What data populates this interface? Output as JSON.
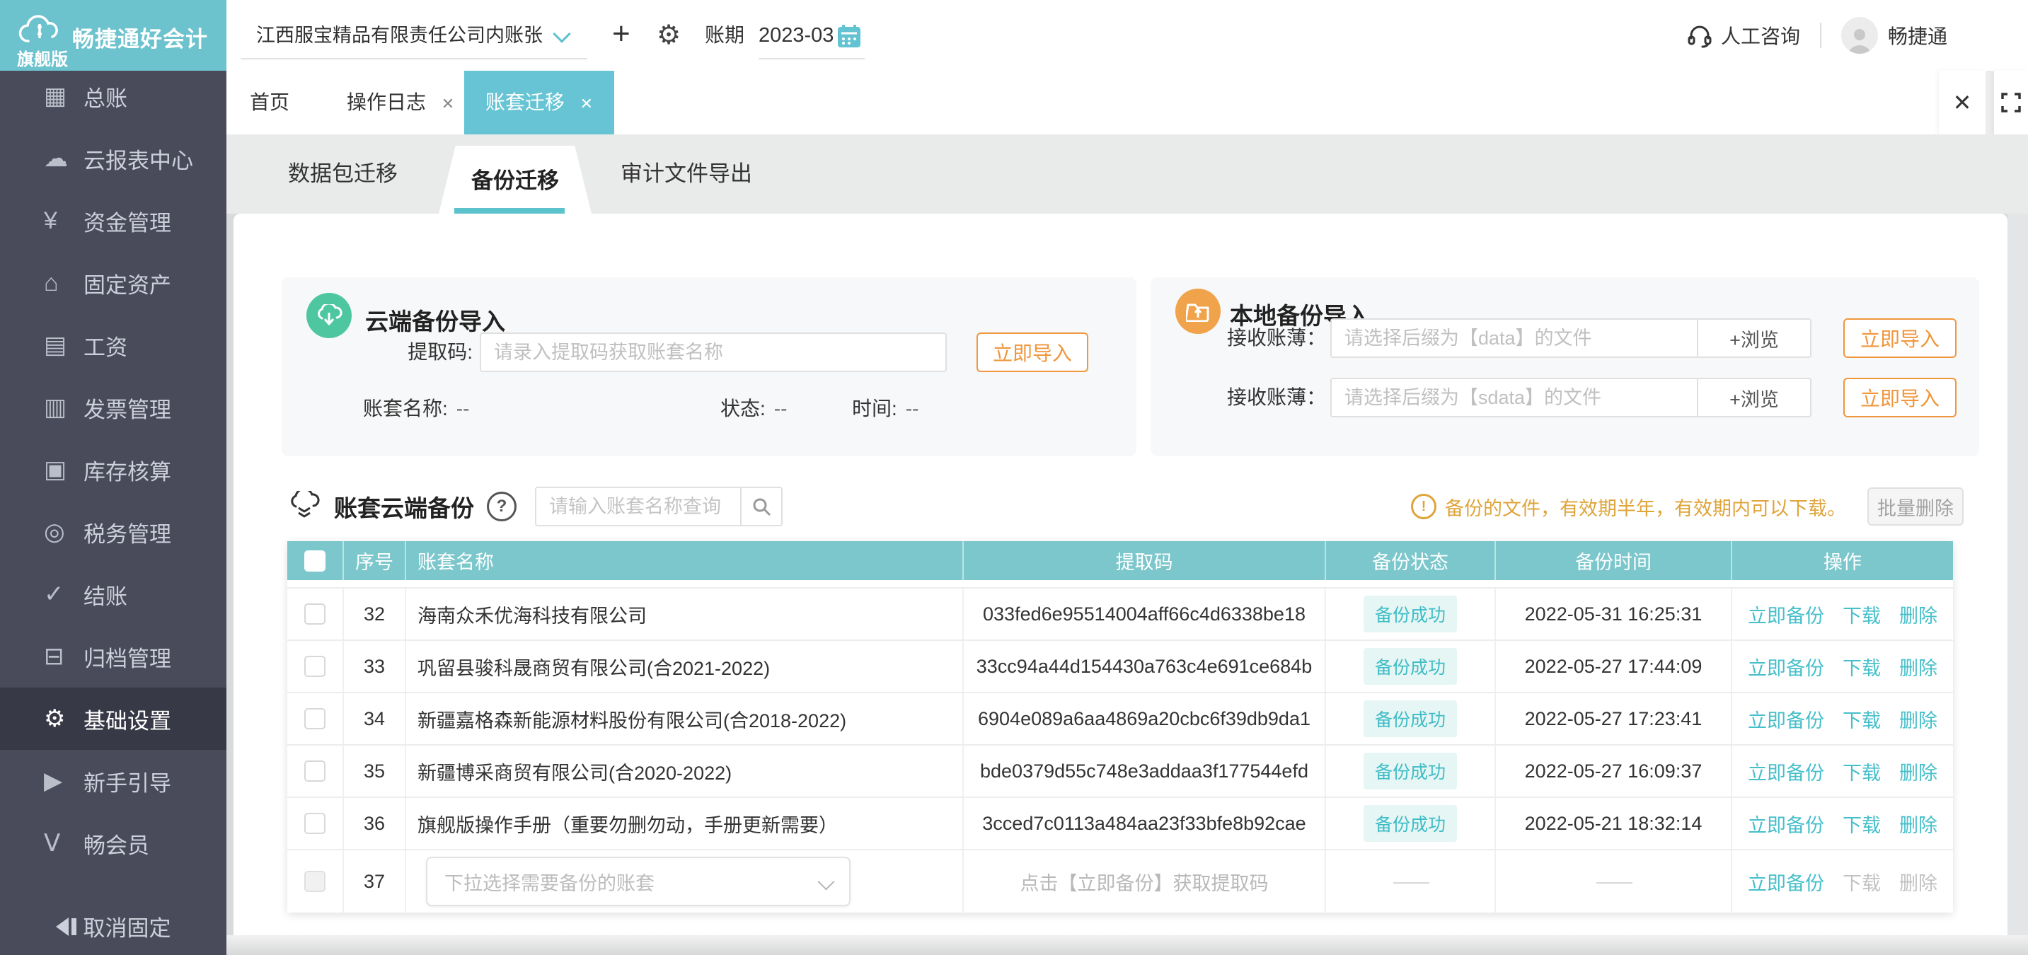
{
  "colors": {
    "logo_teal": "#6cc2cd",
    "active_tab_teal": "#66c4d4",
    "table_header_teal": "#7bc7cc",
    "underline_teal": "#5cc3cd",
    "link_teal": "#45bfca",
    "orange": "#f0963c",
    "green": "#4ec7a0",
    "warning_amber": "#dfa43a",
    "sidebar_dark": "#494a5a",
    "sidebar_selected": "#383947"
  },
  "sidebar": {
    "logo_title": "畅捷通好会计",
    "logo_subtitle": "旗舰版",
    "unpin_label": "取消固定",
    "items": [
      {
        "label": "总账",
        "icon": "▦"
      },
      {
        "label": "云报表中心",
        "icon": "☁"
      },
      {
        "label": "资金管理",
        "icon": "¥"
      },
      {
        "label": "固定资产",
        "icon": "⌂"
      },
      {
        "label": "工资",
        "icon": "▤"
      },
      {
        "label": "发票管理",
        "icon": "▥"
      },
      {
        "label": "库存核算",
        "icon": "▣"
      },
      {
        "label": "税务管理",
        "icon": "◎"
      },
      {
        "label": "结账",
        "icon": "✓"
      },
      {
        "label": "归档管理",
        "icon": "⊟"
      },
      {
        "label": "基础设置",
        "icon": "⚙"
      },
      {
        "label": "新手引导",
        "icon": "▶"
      },
      {
        "label": "畅会员",
        "icon": "Ⅴ"
      }
    ]
  },
  "topbar": {
    "company": "江西服宝精品有限责任公司内账张",
    "plus_glyph": "+",
    "gear_glyph": "⚙",
    "period_label": "账期",
    "period_value": "2023-03",
    "support_label": "人工咨询",
    "user_name": "畅捷通"
  },
  "tabbar": {
    "close_glyph": "✕",
    "tabs": [
      {
        "label": "首页"
      },
      {
        "label": "操作日志"
      },
      {
        "label": "账套迁移"
      }
    ]
  },
  "subtabs": {
    "tabs": [
      "数据包迁移",
      "备份迁移",
      "审计文件导出"
    ]
  },
  "cloud_panel": {
    "title": "云端备份导入",
    "code_label": "提取码:",
    "code_placeholder": "请录入提取码获取账套名称",
    "import_button": "立即导入",
    "name_label": "账套名称:",
    "name_value": "--",
    "status_label": "状态:",
    "status_value": "--",
    "time_label": "时间:",
    "time_value": "--"
  },
  "local_panel": {
    "title": "本地备份导入",
    "rows": [
      {
        "label": "接收账薄：",
        "placeholder": "请选择后缀为【data】的文件",
        "browse": "+浏览",
        "import": "立即导入"
      },
      {
        "label": "接收账薄：",
        "placeholder": "请选择后缀为【sdata】的文件",
        "browse": "+浏览",
        "import": "立即导入"
      }
    ]
  },
  "backup_section": {
    "title": "账套云端备份",
    "help_glyph": "?",
    "search_placeholder": "请输入账套名称查询",
    "notice_glyph": "!",
    "notice": "备份的文件，有效期半年，有效期内可以下载。",
    "batch_delete": "批量删除"
  },
  "table": {
    "headers": [
      "序号",
      "账套名称",
      "提取码",
      "备份状态",
      "备份时间",
      "操作"
    ],
    "actions": {
      "backup": "立即备份",
      "download": "下载",
      "delete": "删除"
    },
    "rows": [
      {
        "seq": "32",
        "name": "海南众禾优海科技有限公司",
        "code": "033fed6e95514004aff66c4d6338be18",
        "status": "备份成功",
        "time": "2022-05-31 16:25:31"
      },
      {
        "seq": "33",
        "name": "巩留县骏科晟商贸有限公司(合2021-2022)",
        "code": "33cc94a44d154430a763c4e691ce684b",
        "status": "备份成功",
        "time": "2022-05-27 17:44:09"
      },
      {
        "seq": "34",
        "name": "新疆嘉格森新能源材料股份有限公司(合2018-2022)",
        "code": "6904e089a6aa4869a20cbc6f39db9da1",
        "status": "备份成功",
        "time": "2022-05-27 17:23:41"
      },
      {
        "seq": "35",
        "name": "新疆博采商贸有限公司(合2020-2022)",
        "code": "bde0379d55c748e3addaa3f177544efd",
        "status": "备份成功",
        "time": "2022-05-27 16:09:37"
      },
      {
        "seq": "36",
        "name": "旗舰版操作手册（重要勿删勿动，手册更新需要）",
        "code": "3cced7c0113a484aa23f33bfe8b92cae",
        "status": "备份成功",
        "time": "2022-05-21 18:32:14"
      }
    ],
    "new_row": {
      "seq": "37",
      "select_placeholder": "下拉选择需要备份的账套",
      "code_hint": "点击【立即备份】获取提取码",
      "dash": "——"
    }
  }
}
